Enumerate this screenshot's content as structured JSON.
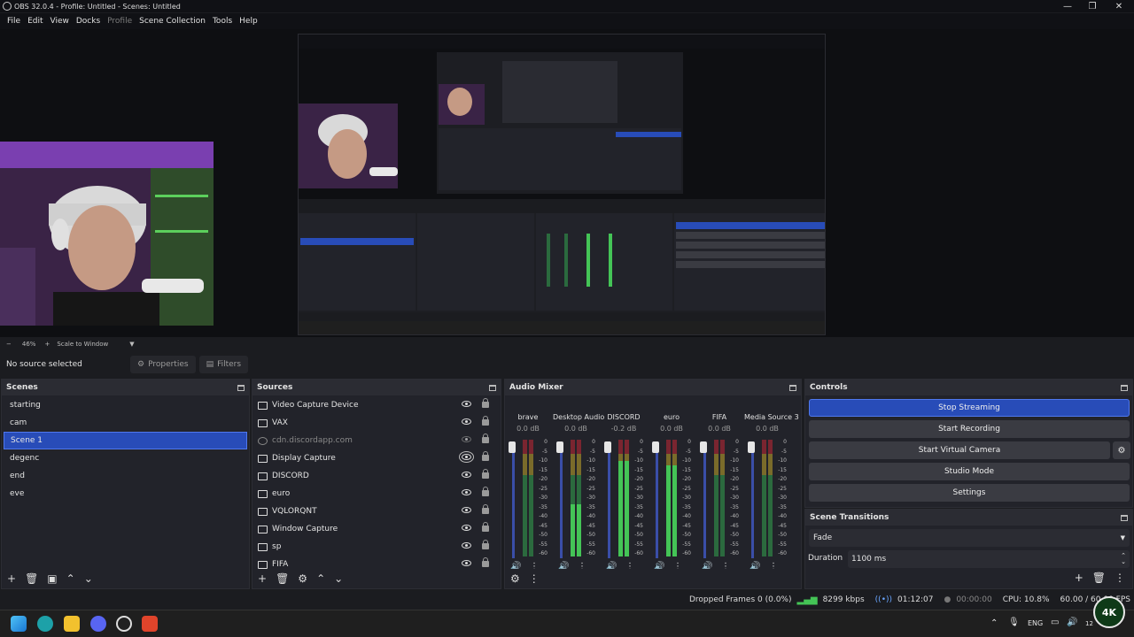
{
  "window": {
    "title": "OBS 32.0.4 - Profile: Untitled - Scenes: Untitled"
  },
  "menu": [
    "File",
    "Edit",
    "View",
    "Docks",
    "Profile",
    "Scene Collection",
    "Tools",
    "Help"
  ],
  "zoom": {
    "minus": "−",
    "percent": "46%",
    "plus": "+",
    "mode": "Scale to Window"
  },
  "source_toolbar": {
    "status": "No source selected",
    "properties": "Properties",
    "filters": "Filters"
  },
  "scenes": {
    "title": "Scenes",
    "items": [
      "starting",
      "cam",
      "Scene 1",
      "degenc",
      "end",
      "eve"
    ],
    "selected": "Scene 1"
  },
  "sources": {
    "title": "Sources",
    "items": [
      {
        "name": "Video Capture Device",
        "visible": true
      },
      {
        "name": "VAX",
        "visible": true
      },
      {
        "name": "cdn.discordapp.com",
        "visible": false
      },
      {
        "name": "Display Capture",
        "visible": true
      },
      {
        "name": "DISCORD",
        "visible": true
      },
      {
        "name": "euro",
        "visible": true
      },
      {
        "name": "VQLORQNT",
        "visible": true
      },
      {
        "name": "Window Capture",
        "visible": true
      },
      {
        "name": "sp",
        "visible": true
      },
      {
        "name": "FIFA",
        "visible": true
      }
    ]
  },
  "mixer": {
    "title": "Audio Mixer",
    "channels": [
      {
        "name": "brave",
        "db": "0.0 dB",
        "level": 0.0,
        "muted": false
      },
      {
        "name": "Desktop Audio",
        "db": "0.0 dB",
        "level": 0.45,
        "muted": true
      },
      {
        "name": "DISCORD",
        "db": "-0.2 dB",
        "level": 0.82,
        "muted": false
      },
      {
        "name": "euro",
        "db": "0.0 dB",
        "level": 0.78,
        "muted": false
      },
      {
        "name": "FIFA",
        "db": "0.0 dB",
        "level": 0.0,
        "muted": false
      },
      {
        "name": "Media Source 3",
        "db": "0.0 dB",
        "level": 0.0,
        "muted": true
      }
    ],
    "scale": [
      "0",
      "-5",
      "-10",
      "-15",
      "-20",
      "-25",
      "-30",
      "-35",
      "-40",
      "-45",
      "-50",
      "-55",
      "-60"
    ]
  },
  "controls": {
    "title": "Controls",
    "buttons": [
      "Stop Streaming",
      "Start Recording",
      "Start Virtual Camera",
      "Studio Mode",
      "Settings"
    ]
  },
  "transitions": {
    "title": "Scene Transitions",
    "type": "Fade",
    "duration_label": "Duration",
    "duration": "1100 ms"
  },
  "status": {
    "dropped": "Dropped Frames 0 (0.0%)",
    "bitrate": "8299 kbps",
    "stream_time": "01:12:07",
    "rec_time": "00:00:00",
    "cpu": "CPU: 10.8%",
    "fps": "60.00 / 60.00 FPS"
  },
  "taskbar": {
    "lang": "ENG",
    "badge": "4K",
    "time": "12"
  },
  "colors": {
    "accent": "#284cb8",
    "bg": "#1b1c20",
    "panel": "#22232a"
  }
}
